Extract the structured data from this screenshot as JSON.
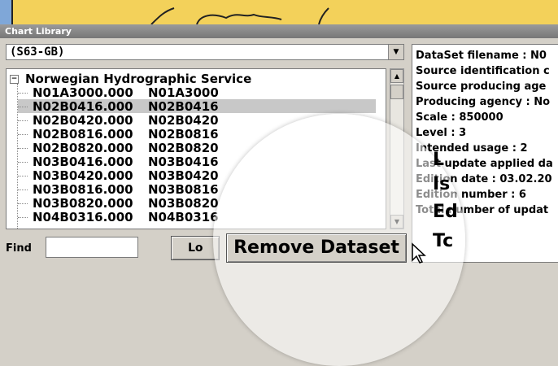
{
  "window": {
    "title": "Chart Library"
  },
  "selector": {
    "value": "(S63-GB)"
  },
  "tree": {
    "root_label": "Norwegian Hydrographic Service",
    "rows": [
      {
        "file": "N01A3000.000",
        "name": "N01A3000"
      },
      {
        "file": "N02B0416.000",
        "name": "N02B0416"
      },
      {
        "file": "N02B0420.000",
        "name": "N02B0420"
      },
      {
        "file": "N02B0816.000",
        "name": "N02B0816"
      },
      {
        "file": "N02B0820.000",
        "name": "N02B0820"
      },
      {
        "file": "N03B0416.000",
        "name": "N03B0416"
      },
      {
        "file": "N03B0420.000",
        "name": "N03B0420"
      },
      {
        "file": "N03B0816.000",
        "name": "N03B0816"
      },
      {
        "file": "N03B0820.000",
        "name": "N03B0820"
      },
      {
        "file": "N04B0316.000",
        "name": "N04B0316"
      }
    ],
    "selected_index": 1
  },
  "find": {
    "label": "Find",
    "value": ""
  },
  "buttons": {
    "load": "Lo",
    "remove": "Remove Dataset"
  },
  "info": {
    "lines": [
      "DataSet filename : N0",
      "Source identification c",
      "Source producing age",
      "Producing agency : No",
      "Scale : 850000",
      "Level : 3",
      "Intended usage : 2",
      "Last update applied da",
      "Edition date : 03.02.20",
      "Edition number : 6",
      "Total number of updat"
    ],
    "big_letters": [
      "L",
      "Is",
      "Ed",
      "Tc"
    ]
  },
  "colors": {
    "map_yellow": "#f3d15a",
    "map_blue": "#7fa7d8",
    "selection": "#c8c8c8"
  }
}
